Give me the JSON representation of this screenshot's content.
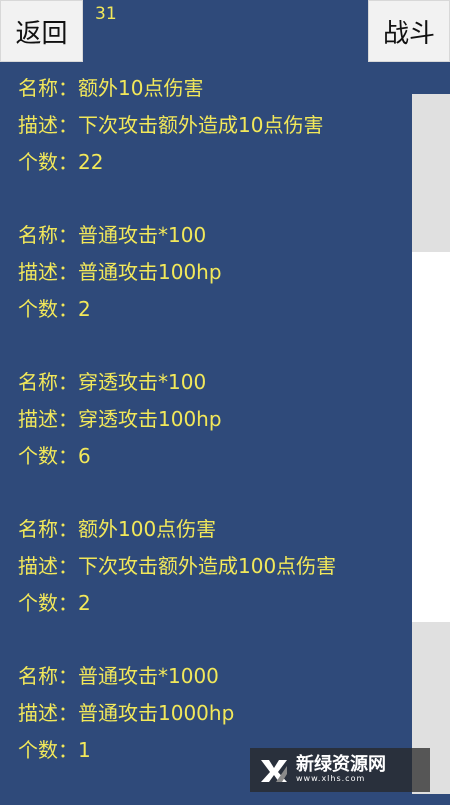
{
  "header": {
    "back_label": "返回",
    "fight_label": "战斗",
    "counter": "31"
  },
  "items": [
    {
      "name_label": "名称：",
      "name": "额外10点伤害",
      "desc_label": "描述：",
      "desc": "下次攻击额外造成10点伤害",
      "count_label": "个数：",
      "count": "22"
    },
    {
      "name_label": "名称：",
      "name": "普通攻击*100",
      "desc_label": "描述：",
      "desc": "普通攻击100hp",
      "count_label": "个数：",
      "count": "2"
    },
    {
      "name_label": "名称：",
      "name": "穿透攻击*100",
      "desc_label": "描述：",
      "desc": "穿透攻击100hp",
      "count_label": "个数：",
      "count": "6"
    },
    {
      "name_label": "名称：",
      "name": "额外100点伤害",
      "desc_label": "描述：",
      "desc": "下次攻击额外造成100点伤害",
      "count_label": "个数：",
      "count": "2"
    },
    {
      "name_label": "名称：",
      "name": "普通攻击*1000",
      "desc_label": "描述：",
      "desc": "普通攻击1000hp",
      "count_label": "个数：",
      "count": "1"
    }
  ],
  "watermark": {
    "title": "新绿资源网",
    "url": "www.xlhs.com"
  },
  "colors": {
    "background": "#2f4a7a",
    "text": "#f2e85a",
    "button": "#f2f2f2"
  }
}
